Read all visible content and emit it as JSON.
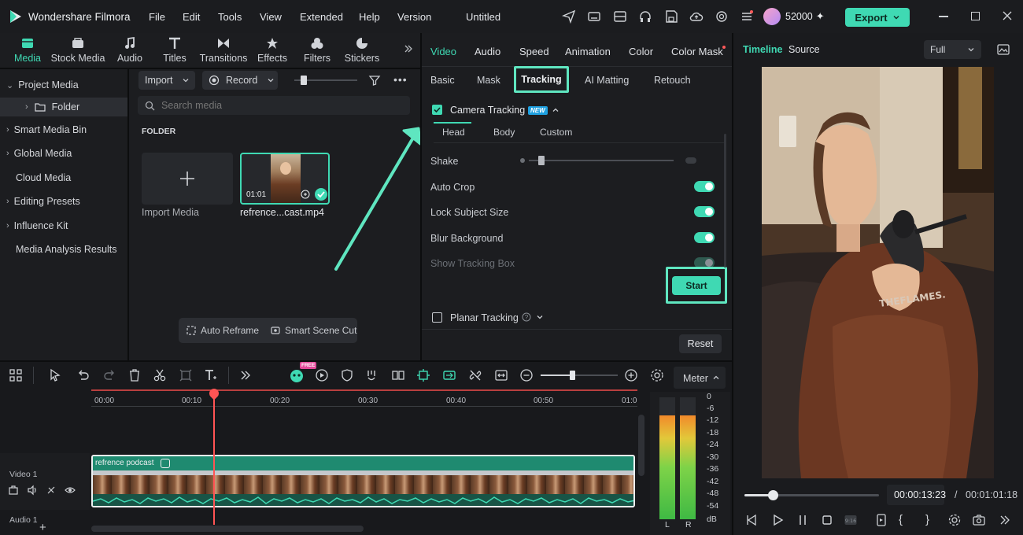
{
  "app": {
    "name": "Wondershare Filmora",
    "project_title": "Untitled",
    "menu": [
      "File",
      "Edit",
      "Tools",
      "View",
      "Extended",
      "Help",
      "Version"
    ],
    "credits": "52000",
    "export_label": "Export",
    "accent": "#3fd9b3"
  },
  "media_tabs": [
    {
      "label": "Media",
      "icon": "media-icon"
    },
    {
      "label": "Stock Media",
      "icon": "stock-media-icon"
    },
    {
      "label": "Audio",
      "icon": "audio-icon"
    },
    {
      "label": "Titles",
      "icon": "titles-icon"
    },
    {
      "label": "Transitions",
      "icon": "transitions-icon"
    },
    {
      "label": "Effects",
      "icon": "effects-icon"
    },
    {
      "label": "Filters",
      "icon": "filters-icon"
    },
    {
      "label": "Stickers",
      "icon": "stickers-icon"
    }
  ],
  "sidebar": {
    "items": [
      {
        "label": "Project Media"
      },
      {
        "label": "Folder"
      },
      {
        "label": "Smart Media Bin"
      },
      {
        "label": "Global Media"
      },
      {
        "label": "Cloud Media"
      },
      {
        "label": "Editing Presets"
      },
      {
        "label": "Influence Kit"
      },
      {
        "label": "Media Analysis Results"
      }
    ]
  },
  "media_toolbar": {
    "import_label": "Import",
    "record_label": "Record",
    "search_placeholder": "Search media",
    "folder_heading": "FOLDER"
  },
  "media_items": [
    {
      "label": "Import Media"
    },
    {
      "label": "refrence...cast.mp4",
      "duration": "01:01"
    }
  ],
  "media_bottom": {
    "auto_reframe": "Auto Reframe",
    "smart_scene_cut": "Smart Scene Cut"
  },
  "properties": {
    "tabs": [
      "Video",
      "Audio",
      "Speed",
      "Animation",
      "Color",
      "Color Mask"
    ],
    "subtabs": [
      "Basic",
      "Mask",
      "Tracking",
      "AI Matting",
      "Retouch"
    ],
    "camera_tracking_label": "Camera Tracking",
    "new_badge": "NEW",
    "tracking_modes": [
      "Head",
      "Body",
      "Custom"
    ],
    "shake_label": "Shake",
    "options": [
      {
        "label": "Auto Crop",
        "enabled": true
      },
      {
        "label": "Lock Subject Size",
        "enabled": true
      },
      {
        "label": "Blur Background",
        "enabled": true
      },
      {
        "label": "Show Tracking Box",
        "enabled": false
      }
    ],
    "start_label": "Start",
    "planar_tracking_label": "Planar Tracking",
    "reset_label": "Reset"
  },
  "preview": {
    "tabs": [
      "Timeline",
      "Source"
    ],
    "quality": "Full",
    "current_time": "00:00:13:23",
    "separator": "/",
    "total_time": "00:01:01:18",
    "progress_fraction": 0.21
  },
  "timeline": {
    "ruler": [
      "00:00",
      "00:10",
      "00:20",
      "00:30",
      "00:40",
      "00:50",
      "01:0"
    ],
    "free_badge": "FREE",
    "meter_label": "Meter",
    "meter_scale": [
      "0",
      "-6",
      "-12",
      "-18",
      "-24",
      "-30",
      "-36",
      "-42",
      "-48",
      "-54",
      "dB"
    ],
    "meter_channels": [
      "L",
      "R"
    ],
    "tracks": [
      {
        "label": "Video 1",
        "clip_name": "refrence podcast"
      },
      {
        "label": "Audio 1"
      }
    ]
  }
}
